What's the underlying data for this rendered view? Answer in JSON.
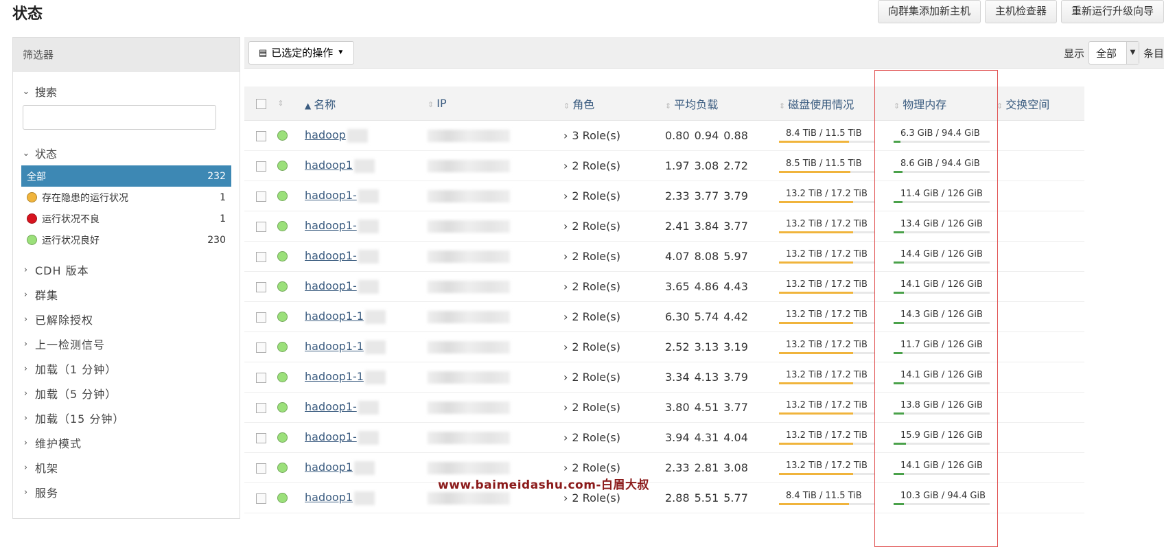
{
  "page_title": "状态",
  "top_buttons": {
    "add_host": "向群集添加新主机",
    "host_inspector": "主机检查器",
    "rerun_upgrade": "重新运行升级向导"
  },
  "sidebar": {
    "header": "筛选器",
    "search_label": "搜索",
    "status_label": "状态",
    "status_items": [
      {
        "label": "全部",
        "count": "232"
      },
      {
        "label": "存在隐患的运行状况",
        "count": "1"
      },
      {
        "label": "运行状况不良",
        "count": "1"
      },
      {
        "label": "运行状况良好",
        "count": "230"
      }
    ],
    "collapsed_sections": [
      "CDH 版本",
      "群集",
      "已解除授权",
      "上一检测信号",
      "加载（1 分钟）",
      "加载（5 分钟）",
      "加载（15 分钟）",
      "维护模式",
      "机架",
      "服务"
    ]
  },
  "toolbar": {
    "selected_actions": "已选定的操作",
    "display_label": "显示",
    "display_value": "全部",
    "entries_label": "条目"
  },
  "table": {
    "headers": {
      "name": "名称",
      "ip": "IP",
      "role": "角色",
      "load": "平均负载",
      "disk": "磁盘使用情况",
      "memory": "物理内存",
      "swap": "交换空间"
    },
    "rows": [
      {
        "name": "hadoop",
        "roles": "3 Role(s)",
        "load": [
          "0.80",
          "0.94",
          "0.88"
        ],
        "disk": "8.4 TiB / 11.5 TiB",
        "disk_frac": 0.73,
        "mem": "6.3 GiB / 94.4 GiB",
        "mem_frac": 0.07
      },
      {
        "name": "hadoop1",
        "roles": "2 Role(s)",
        "load": [
          "1.97",
          "3.08",
          "2.72"
        ],
        "disk": "8.5 TiB / 11.5 TiB",
        "disk_frac": 0.74,
        "mem": "8.6 GiB / 94.4 GiB",
        "mem_frac": 0.09
      },
      {
        "name": "hadoop1-",
        "roles": "2 Role(s)",
        "load": [
          "2.33",
          "3.77",
          "3.79"
        ],
        "disk": "13.2 TiB / 17.2 TiB",
        "disk_frac": 0.77,
        "mem": "11.4 GiB / 126 GiB",
        "mem_frac": 0.09
      },
      {
        "name": "hadoop1-",
        "roles": "2 Role(s)",
        "load": [
          "2.41",
          "3.84",
          "3.77"
        ],
        "disk": "13.2 TiB / 17.2 TiB",
        "disk_frac": 0.77,
        "mem": "13.4 GiB / 126 GiB",
        "mem_frac": 0.11
      },
      {
        "name": "hadoop1-",
        "roles": "2 Role(s)",
        "load": [
          "4.07",
          "8.08",
          "5.97"
        ],
        "disk": "13.2 TiB / 17.2 TiB",
        "disk_frac": 0.77,
        "mem": "14.4 GiB / 126 GiB",
        "mem_frac": 0.11
      },
      {
        "name": "hadoop1-",
        "roles": "2 Role(s)",
        "load": [
          "3.65",
          "4.86",
          "4.43"
        ],
        "disk": "13.2 TiB / 17.2 TiB",
        "disk_frac": 0.77,
        "mem": "14.1 GiB / 126 GiB",
        "mem_frac": 0.11
      },
      {
        "name": "hadoop1-1",
        "roles": "2 Role(s)",
        "load": [
          "6.30",
          "5.74",
          "4.42"
        ],
        "disk": "13.2 TiB / 17.2 TiB",
        "disk_frac": 0.77,
        "mem": "14.3 GiB / 126 GiB",
        "mem_frac": 0.11
      },
      {
        "name": "hadoop1-1",
        "roles": "2 Role(s)",
        "load": [
          "2.52",
          "3.13",
          "3.19"
        ],
        "disk": "13.2 TiB / 17.2 TiB",
        "disk_frac": 0.77,
        "mem": "11.7 GiB / 126 GiB",
        "mem_frac": 0.09
      },
      {
        "name": "hadoop1-1",
        "roles": "2 Role(s)",
        "load": [
          "3.34",
          "4.13",
          "3.79"
        ],
        "disk": "13.2 TiB / 17.2 TiB",
        "disk_frac": 0.77,
        "mem": "14.1 GiB / 126 GiB",
        "mem_frac": 0.11
      },
      {
        "name": "hadoop1-",
        "roles": "2 Role(s)",
        "load": [
          "3.80",
          "4.51",
          "3.77"
        ],
        "disk": "13.2 TiB / 17.2 TiB",
        "disk_frac": 0.77,
        "mem": "13.8 GiB / 126 GiB",
        "mem_frac": 0.11
      },
      {
        "name": "hadoop1-",
        "roles": "2 Role(s)",
        "load": [
          "3.94",
          "4.31",
          "4.04"
        ],
        "disk": "13.2 TiB / 17.2 TiB",
        "disk_frac": 0.77,
        "mem": "15.9 GiB / 126 GiB",
        "mem_frac": 0.13
      },
      {
        "name": "hadoop1",
        "roles": "2 Role(s)",
        "load": [
          "2.33",
          "2.81",
          "3.08"
        ],
        "disk": "13.2 TiB / 17.2 TiB",
        "disk_frac": 0.77,
        "mem": "14.1 GiB / 126 GiB",
        "mem_frac": 0.11
      },
      {
        "name": "hadoop1",
        "roles": "2 Role(s)",
        "load": [
          "2.88",
          "5.51",
          "5.77"
        ],
        "disk": "8.4 TiB / 11.5 TiB",
        "disk_frac": 0.73,
        "mem": "10.3 GiB / 94.4 GiB",
        "mem_frac": 0.11
      }
    ]
  },
  "watermark": "www.baimeidashu.com-白眉大叔",
  "colors": {
    "active_filter": "#3d88b4",
    "link": "#3b5c80",
    "highlight_box": "#e05050",
    "good": "#9be07a",
    "bad": "#d7141f",
    "warning": "#f0b43c"
  }
}
